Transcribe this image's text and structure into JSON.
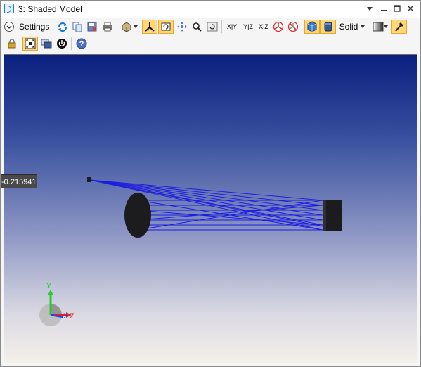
{
  "window": {
    "title": "3: Shaded Model"
  },
  "toolbar": {
    "settings_label": "Settings",
    "x_y_label": "X|Y",
    "y_z_label": "Y|Z",
    "x_z_label": "X|Z",
    "render_mode": "Solid"
  },
  "viewport": {
    "coord_readout": "-0.215941(",
    "axis": {
      "y": "Y",
      "x": "X",
      "z": "Z"
    },
    "colors": {
      "rays": "#1e1ee0",
      "components": "#1c1c1e"
    }
  }
}
